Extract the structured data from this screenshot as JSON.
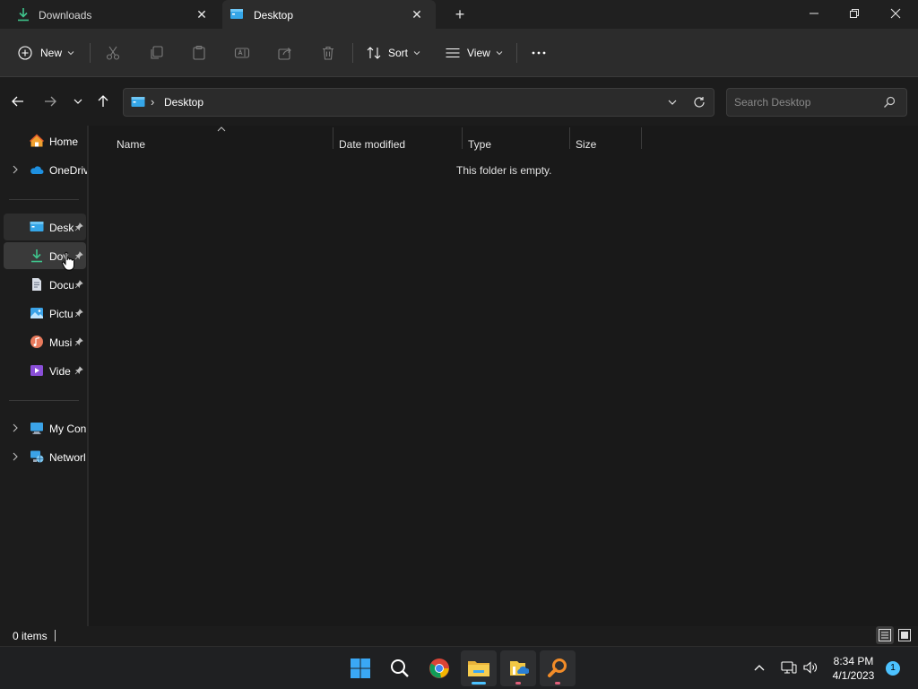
{
  "tabs": [
    {
      "label": "Downloads",
      "icon": "download-icon",
      "active": false
    },
    {
      "label": "Desktop",
      "icon": "desktop-folder-icon",
      "active": true
    }
  ],
  "window": {
    "minimize": "minimize-icon",
    "maximize": "restore-icon",
    "close": "close-icon"
  },
  "toolbar": {
    "new_label": "New",
    "sort_label": "Sort",
    "view_label": "View",
    "disabled_actions": [
      "cut",
      "copy",
      "paste",
      "rename",
      "share",
      "delete"
    ]
  },
  "address": {
    "crumbs": [
      "Desktop"
    ]
  },
  "search": {
    "placeholder": "Search Desktop"
  },
  "nav": {
    "items": [
      {
        "label": "Home",
        "icon": "home-icon"
      },
      {
        "label": "OneDriv",
        "icon": "onedrive-icon",
        "expandable": true
      },
      {
        "label": "Desk",
        "icon": "desktop-folder-icon",
        "pinned": true,
        "state": "hover"
      },
      {
        "label": "Dov",
        "icon": "download-icon",
        "pinned": true,
        "state": "selected"
      },
      {
        "label": "Docu",
        "icon": "documents-icon",
        "pinned": true
      },
      {
        "label": "Pictu",
        "icon": "pictures-icon",
        "pinned": true
      },
      {
        "label": "Musi",
        "icon": "music-icon",
        "pinned": true
      },
      {
        "label": "Vide",
        "icon": "videos-icon",
        "pinned": true
      },
      {
        "label": "My Con",
        "icon": "this-pc-icon",
        "expandable": true
      },
      {
        "label": "Networl",
        "icon": "network-icon",
        "expandable": true
      }
    ]
  },
  "columns": [
    "Name",
    "Date modified",
    "Type",
    "Size"
  ],
  "empty_message": "This folder is empty.",
  "status": {
    "item_count": "0 items"
  },
  "taskbar": {
    "apps": [
      "start-icon",
      "search-icon",
      "chrome-icon",
      "file-explorer-icon",
      "pinned-app-icon",
      "magnifier-app-icon"
    ]
  },
  "clock": {
    "time": "8:34 PM",
    "date": "4/1/2023"
  },
  "notifications": {
    "count": "1"
  },
  "colors": {
    "accent": "#4cc2ff",
    "background": "#191919",
    "chrome": "#2c2c2c"
  }
}
